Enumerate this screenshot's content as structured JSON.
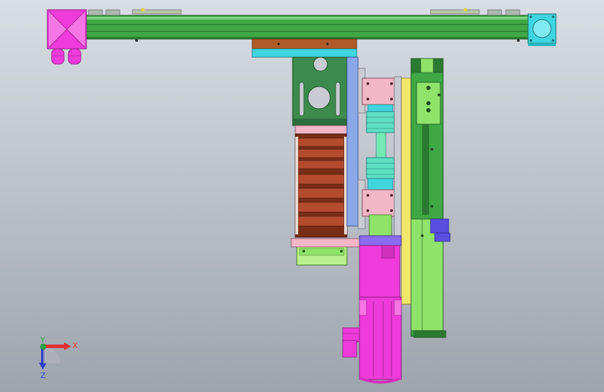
{
  "viewport": {
    "background_top": "#d9dde4",
    "background_bottom": "#9ea4ad"
  },
  "triad": {
    "x_label": "X",
    "y_label": "Y",
    "z_label": "Z",
    "x_color": "#e23030",
    "y_color": "#27a844",
    "z_color": "#2c3fc6"
  },
  "colors": {
    "beam": "#3fa845",
    "motor_magenta": "#ee3bd9",
    "cyan_block": "#3fd6e0",
    "pink_block": "#f2b6c6",
    "lime": "#8fe36a",
    "cable_chain": "#b44a2e",
    "bracket_green": "#3d8a4f",
    "rail_yellow": "#f1e76a",
    "blue_plate": "#8aa8e8"
  }
}
